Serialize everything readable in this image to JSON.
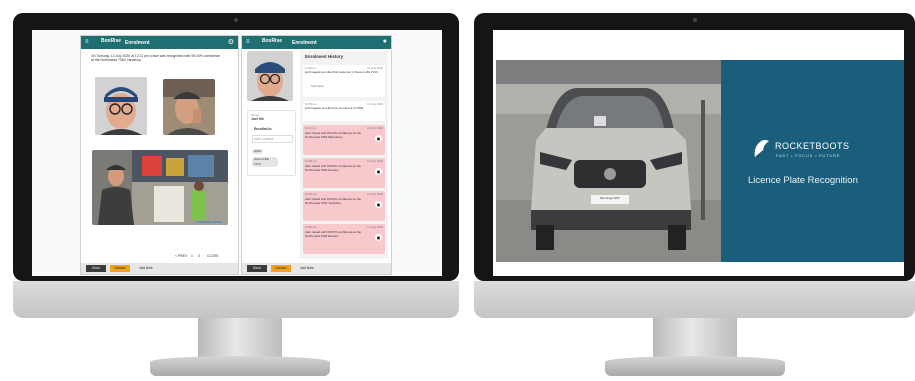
{
  "left_app": {
    "panel1": {
      "brand": "BoxRise",
      "title": "Enrolment",
      "description": "On Tuesday, 14 July 2020 at 12:11 pm a face was recognised with 99.44% confidence at the Northmead 7064 Yardshop.",
      "compare_link": "COMPARE FACES",
      "pagination": {
        "prev": "< PREV",
        "page_a": "1",
        "page_b": "2",
        "next": "CLOSE"
      },
      "buttons": {
        "b1": "Enrol",
        "b2": "Dismiss",
        "b3": "Add Note"
      }
    },
    "panel2": {
      "brand": "BoxRise",
      "title": "Enrolment",
      "name_label": "Name",
      "name_value": "Joel Ott",
      "enrolled_label": "Enrolled in",
      "add_location": "Add Location",
      "chip1": "NSW",
      "chip2": "Seven Hills 7213",
      "history_title": "Enrolment History",
      "history": [
        {
          "time": "11:15 pm",
          "date": "15 July 2020",
          "text": "josh.nagasit enrolled this customer in Seven Hills 7213",
          "note": "Test Note",
          "alert": false
        },
        {
          "time": "10:50 am",
          "date": "14 July 2020",
          "text": "josh.nagasit enrolled this enrolment to NSW",
          "note": "",
          "alert": false
        },
        {
          "time": "12:11 pm",
          "date": "14 July 2020",
          "text": "Alert raised with 99.44% confidence at the Northmead 7064 Main Entry",
          "note": "",
          "alert": true
        },
        {
          "time": "12:09 pm",
          "date": "14 July 2020",
          "text": "Alert raised with 99.63% confidence at the Northmead 7064 Nursery",
          "note": "",
          "alert": true
        },
        {
          "time": "12:05 pm",
          "date": "14 July 2020",
          "text": "Alert raised with 99.02% confidence at the Northmead 7064 Yardshop",
          "note": "",
          "alert": true
        },
        {
          "time": "11:58 am",
          "date": "14 July 2020",
          "text": "Alert raised with 99.57% confidence at the Northmead 7064 Returns",
          "note": "",
          "alert": true
        }
      ],
      "buttons": {
        "b1": "Enrol",
        "b2": "Dismiss",
        "b3": "Add Note"
      }
    }
  },
  "right_screen": {
    "brand_name": "ROCKETBOOTS",
    "tagline": "FAST • FOCUS • FUTURE",
    "heading": "Licence Plate Recognition",
    "car_badge": "Bunnings LPR",
    "brand_color": "#1b5e7b"
  },
  "colors": {
    "app_header": "#1f6f72",
    "alert_bg": "#f7c9cd",
    "accent_button": "#f2a21d"
  }
}
